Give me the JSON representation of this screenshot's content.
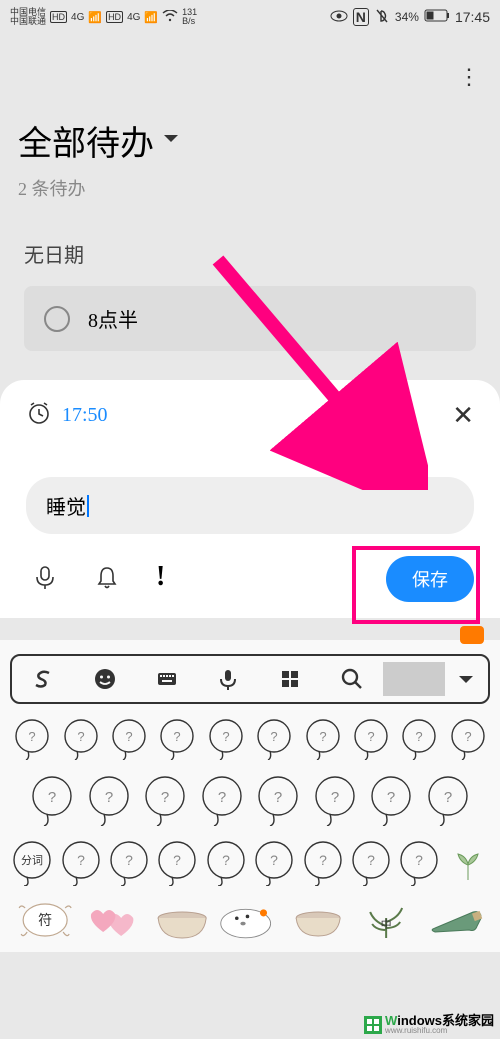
{
  "status": {
    "carrier1": "中国电信",
    "carrier2": "中国联通",
    "hd": "HD",
    "net1": "4G",
    "net2": "4G",
    "speed": "131",
    "speed_unit": "B/s",
    "battery": "34%",
    "time": "17:45"
  },
  "header": {
    "title": "全部待办",
    "subtitle": "2 条待办"
  },
  "nodate_label": "无日期",
  "todo": {
    "text": "8点半"
  },
  "sheet": {
    "time": "17:50",
    "input_value": "睡觉",
    "save_label": "保存"
  },
  "labels": {
    "fenci": "分词",
    "fu": "符"
  },
  "watermark": {
    "brand_prefix": "W",
    "brand_rest": "indows",
    "suffix": "系统家园",
    "url": "www.ruishifu.com"
  }
}
